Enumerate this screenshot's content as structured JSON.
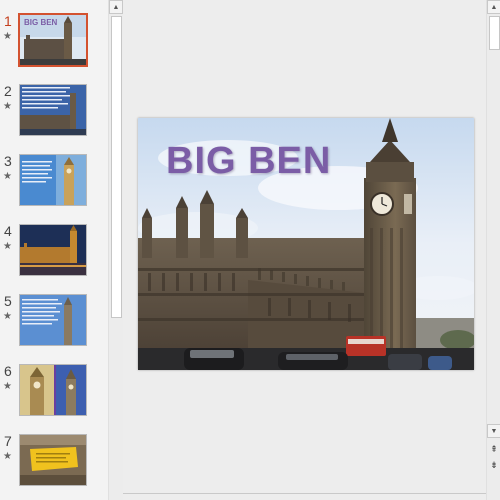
{
  "slide_title": "BIG BEN",
  "thumbnails": [
    {
      "number": "1",
      "star": "★",
      "selected": true,
      "title": "BIG BEN"
    },
    {
      "number": "2",
      "star": "★",
      "selected": false
    },
    {
      "number": "3",
      "star": "★",
      "selected": false
    },
    {
      "number": "4",
      "star": "★",
      "selected": false
    },
    {
      "number": "5",
      "star": "★",
      "selected": false
    },
    {
      "number": "6",
      "star": "★",
      "selected": false
    },
    {
      "number": "7",
      "star": "★",
      "selected": false
    }
  ],
  "icons": {
    "scroll_up": "▲",
    "scroll_down": "▼",
    "prev_slide": "⇞",
    "next_slide": "⇟"
  },
  "colors": {
    "title": "#7b5da6",
    "selection_border": "#d35230",
    "active_number": "#c43e1c"
  }
}
